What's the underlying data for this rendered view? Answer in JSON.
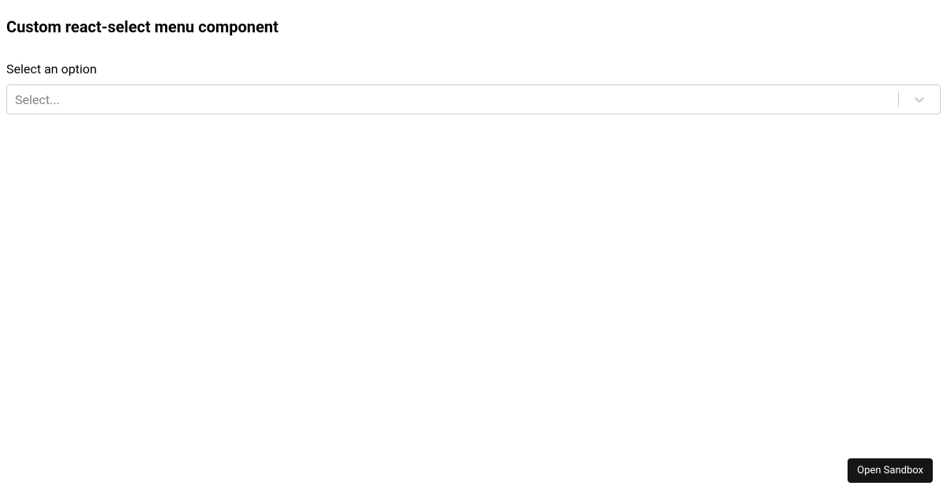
{
  "page": {
    "title": "Custom react-select menu component",
    "label": "Select an option"
  },
  "select": {
    "placeholder": "Select..."
  },
  "footer": {
    "sandbox_button": "Open Sandbox"
  }
}
